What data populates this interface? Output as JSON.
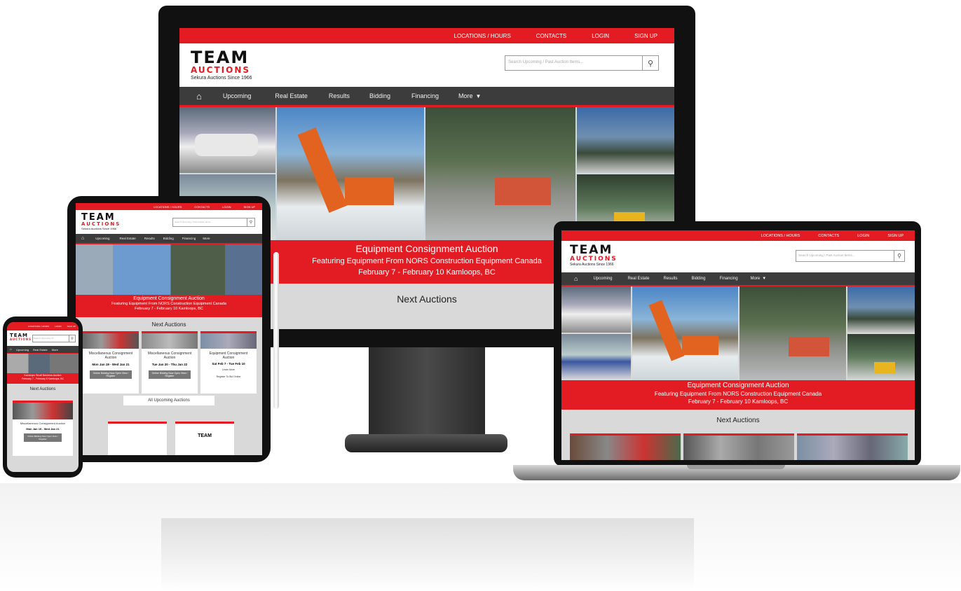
{
  "brand": {
    "name_top": "TEAM",
    "name_bottom": "AUCTIONS",
    "tagline": "Sekura Auctions Since 1966"
  },
  "topbar": {
    "locations": "LOCATIONS / HOURS",
    "contacts": "CONTACTS",
    "login": "LOGIN",
    "signup": "SIGN UP"
  },
  "search": {
    "placeholder": "Search Upcoming / Past Auction Items...",
    "placeholder_short": "Search Upcoming / P..."
  },
  "nav": {
    "items": [
      "Upcoming",
      "Real Estate",
      "Results",
      "Bidding",
      "Financing",
      "More"
    ]
  },
  "banner": {
    "title": "Equipment Consignment Auction",
    "subtitle": "Featuring Equipment From NORS Construction Equipment Canada",
    "dates": "February 7 - February 10 Kamloops, BC"
  },
  "section": {
    "next_auctions": "Next Auctions",
    "all_upcoming": "All Upcoming Auctions"
  },
  "auctions": [
    {
      "title": "Miscellaneous Consignment Auction",
      "dates": "Mon Jan 19 - Wed Jan 21",
      "button": "Online Bidding Now Open View / Register"
    },
    {
      "title": "Miscellaneous Consignment Auction",
      "dates": "Tue Jan 20 - Thu Jan 22",
      "button": "Online Bidding Now Open View / Register"
    },
    {
      "title": "Equipment Consignment Auction",
      "dates": "Sat Feb 7 - Tue Feb 10",
      "button": "Learn More",
      "button2": "Register To Bid Online"
    }
  ],
  "phone_banner": {
    "title": "Kamloops Small Business Auction",
    "dates": "February 7 - February 8 Kamloops, BC"
  },
  "colors": {
    "brand_red": "#e31b23",
    "nav_dark": "#3c3c3c",
    "bezel": "#111111"
  },
  "icons": {
    "home": "home-icon",
    "search": "search-icon",
    "chevron": "chevron-down-icon"
  }
}
